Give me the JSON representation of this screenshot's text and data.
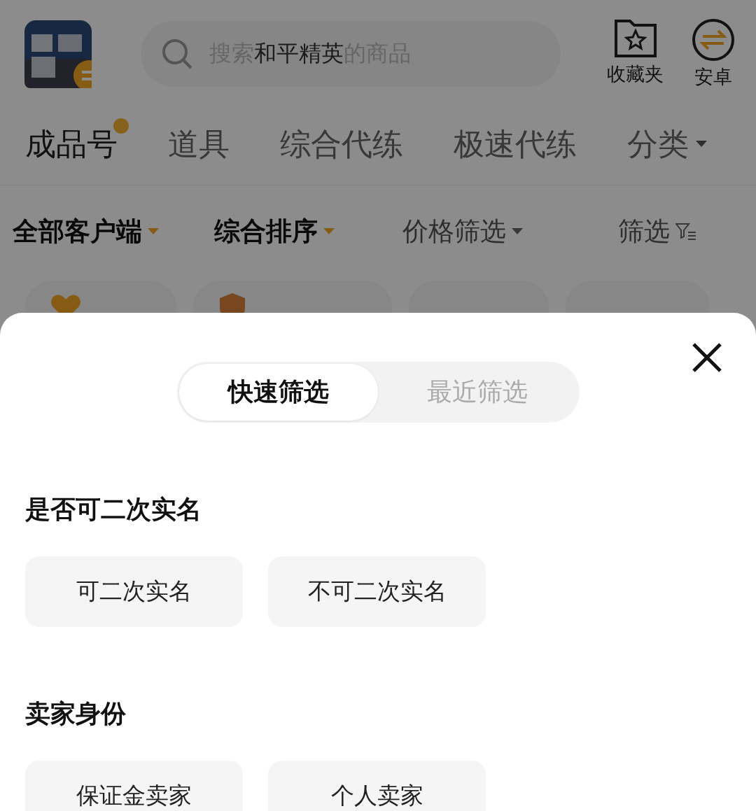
{
  "header": {
    "search": {
      "placeholder": "搜索**和平精英**的商品"
    },
    "actions": [
      {
        "label": "收藏夹",
        "kind": "favorites"
      },
      {
        "label": "安卓",
        "kind": "platform"
      }
    ]
  },
  "tabs": [
    {
      "label": "成品号",
      "selected": true,
      "dot": true,
      "kind": "plain"
    },
    {
      "label": "道具",
      "selected": false,
      "dot": false,
      "kind": "plain"
    },
    {
      "label": "综合代练",
      "selected": false,
      "dot": false,
      "kind": "plain"
    },
    {
      "label": "极速代练",
      "selected": false,
      "dot": false,
      "kind": "plain"
    },
    {
      "label": "分类",
      "selected": false,
      "dot": false,
      "kind": "dropdown"
    }
  ],
  "filters": [
    {
      "label": "全部客户端",
      "active": true,
      "kind": "dropdown"
    },
    {
      "label": "综合排序",
      "active": true,
      "kind": "dropdown"
    },
    {
      "label": "价格筛选",
      "active": false,
      "kind": "dropdown"
    },
    {
      "label": "筛选",
      "active": false,
      "kind": "filter"
    }
  ],
  "chips": [
    {
      "kind": "heart"
    },
    {
      "kind": "shield"
    },
    {
      "kind": "plain"
    },
    {
      "kind": "plain"
    }
  ],
  "sheet": {
    "segments": [
      {
        "label": "快速筛选",
        "selected": true
      },
      {
        "label": "最近筛选",
        "selected": false
      }
    ],
    "sections": [
      {
        "title": "是否可二次实名",
        "options": [
          {
            "label": "可二次实名",
            "selected": false
          },
          {
            "label": "不可二次实名",
            "selected": false
          }
        ]
      },
      {
        "title": "卖家身份",
        "options": [
          {
            "label": "保证金卖家",
            "selected": false
          },
          {
            "label": "个人卖家",
            "selected": false
          }
        ]
      }
    ]
  }
}
